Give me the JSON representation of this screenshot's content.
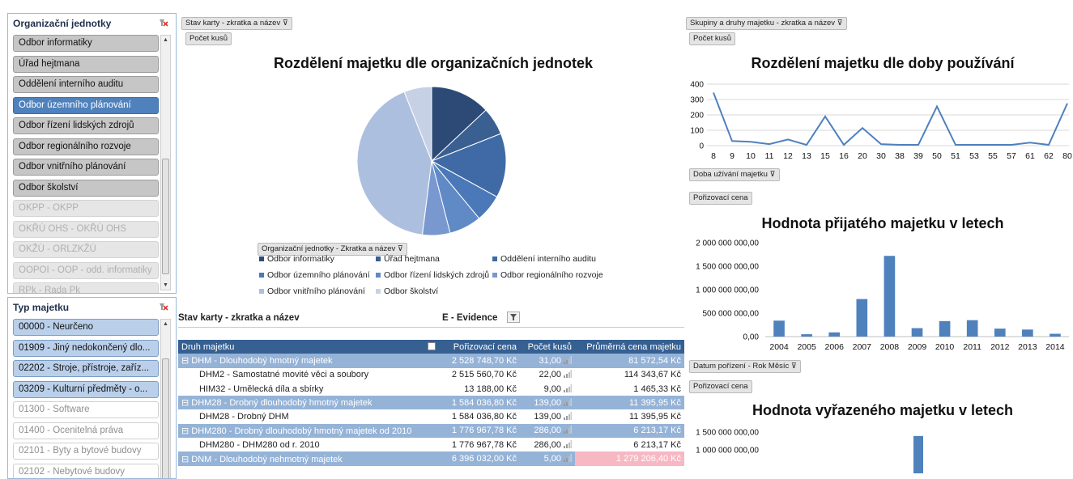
{
  "slicer_org": {
    "title": "Organizační jednotky",
    "items": [
      {
        "label": "Odbor informatiky",
        "state": "grey"
      },
      {
        "label": "Úřad hejtmana",
        "state": "grey"
      },
      {
        "label": "Oddělení interního auditu",
        "state": "grey"
      },
      {
        "label": "Odbor územního plánování",
        "state": "sel"
      },
      {
        "label": "Odbor řízení lidských zdrojů",
        "state": "grey"
      },
      {
        "label": "Odbor regionálního rozvoje",
        "state": "grey"
      },
      {
        "label": "Odbor vnitřního plánování",
        "state": "grey"
      },
      {
        "label": "Odbor školství",
        "state": "grey"
      },
      {
        "label": "OKPP - OKPP",
        "state": "light"
      },
      {
        "label": "OKŘÚ OHS - OKŘÚ OHS",
        "state": "light"
      },
      {
        "label": "OKŽÚ - ORLZKŽÚ",
        "state": "light"
      },
      {
        "label": "OOPOI - OOP - odd. informatiky",
        "state": "light"
      },
      {
        "label": "RPk - Rada Pk",
        "state": "light"
      }
    ]
  },
  "slicer_type": {
    "title": "Typ majetku",
    "items": [
      {
        "label": "00000 - Neurčeno",
        "state": "blue"
      },
      {
        "label": "01909 - Jiný nedokončený dlo...",
        "state": "blue"
      },
      {
        "label": "02202 - Stroje, přístroje, zaříz...",
        "state": "blue"
      },
      {
        "label": "03209 - Kulturní předměty - o...",
        "state": "blue"
      },
      {
        "label": "01300 - Software",
        "state": "white"
      },
      {
        "label": "01400 - Ocenitelná práva",
        "state": "white"
      },
      {
        "label": "02101 - Byty a bytové budovy",
        "state": "white"
      },
      {
        "label": "02102 - Nebytové budovy",
        "state": "white"
      }
    ]
  },
  "pie_section": {
    "filter_button": "Stav karty - zkratka a název",
    "value_button": "Počet kusů",
    "title": "Rozdělení majetku dle organizačních jednotek",
    "legend_button": "Organizační jednotky - Zkratka a název"
  },
  "line_section": {
    "filter_button": "Skupiny a druhy majetku - zkratka a název",
    "value_button": "Počet kusů",
    "title": "Rozdělení majetku dle doby používání",
    "axis_button": "Doba užívání majetku"
  },
  "bar1_section": {
    "value_button": "Pořizovací cena",
    "title": "Hodnota přijatého majetku v letech",
    "axis_button": "Datum pořízení - Rok Měsíc"
  },
  "bar2_section": {
    "value_button": "Pořizovací cena",
    "title": "Hodnota vyřazeného majetku v letech"
  },
  "chart_data": [
    {
      "type": "pie",
      "title": "Rozdělení majetku dle organizačních jednotek",
      "categories": [
        "Odbor informatiky",
        "Úřad hejtmana",
        "Oddělení interního auditu",
        "Odbor územního plánování",
        "Odbor řízení lidských zdrojů",
        "Odbor regionálního rozvoje",
        "Odbor vnitřního plánování",
        "Odbor školství"
      ],
      "values": [
        13,
        6,
        14,
        6,
        7,
        6,
        42,
        6
      ],
      "colors": [
        "#2c4a75",
        "#3a5f91",
        "#3f6aa6",
        "#4a78b8",
        "#5f8ac6",
        "#7898cf",
        "#adbfdf",
        "#c7d1e6"
      ]
    },
    {
      "type": "line",
      "title": "Rozdělení majetku dle doby používání",
      "x": [
        "8",
        "9",
        "10",
        "11",
        "12",
        "13",
        "15",
        "16",
        "20",
        "30",
        "38",
        "39",
        "50",
        "51",
        "53",
        "55",
        "57",
        "61",
        "62",
        "80"
      ],
      "values": [
        345,
        30,
        25,
        10,
        40,
        5,
        190,
        5,
        115,
        10,
        5,
        5,
        255,
        5,
        5,
        5,
        5,
        20,
        5,
        275
      ],
      "ylim": [
        0,
        400
      ],
      "yticks": [
        "400",
        "300",
        "200",
        "100",
        "0"
      ]
    },
    {
      "type": "bar",
      "title": "Hodnota přijatého majetku v letech",
      "categories": [
        "2004",
        "2005",
        "2006",
        "2007",
        "2008",
        "2009",
        "2010",
        "2011",
        "2012",
        "2013",
        "2014"
      ],
      "values": [
        340000000,
        50000000,
        90000000,
        800000000,
        1720000000,
        180000000,
        330000000,
        350000000,
        170000000,
        150000000,
        60000000
      ],
      "ylim": [
        0,
        2000000000
      ],
      "yticks": [
        "2 000 000 000,00",
        "1 500 000 000,00",
        "1 000 000 000,00",
        "500 000 000,00",
        "0,00"
      ]
    },
    {
      "type": "bar",
      "title": "Hodnota vyřazeného majetku v letech",
      "categories": [],
      "values": [
        1390000000
      ],
      "ylim": [
        0,
        1500000000
      ],
      "yticks": [
        "1 500 000 000,00",
        "1 000 000 000,00"
      ]
    }
  ],
  "table": {
    "top_label": "Stav karty - zkratka a název",
    "top_value": "E - Evidence",
    "headers": [
      "Druh majetku",
      "Pořizovací cena",
      "Počet kusů",
      "Průměrná cena majetku"
    ],
    "rows": [
      {
        "kind": "grp",
        "name": "DHM - Dlouhodobý hmotný majetek",
        "cena": "2 528 748,70 Kč",
        "kusu": "31,00",
        "prumer": "81 572,54 Kč"
      },
      {
        "kind": "sub",
        "name": "DHM2 - Samostatné movité věci a soubory",
        "cena": "2 515 560,70 Kč",
        "kusu": "22,00",
        "prumer": "114 343,67 Kč"
      },
      {
        "kind": "sub",
        "name": "HIM32 - Umělecká díla a sbírky",
        "cena": "13 188,00 Kč",
        "kusu": "9,00",
        "prumer": "1 465,33 Kč"
      },
      {
        "kind": "grp",
        "name": "DHM28 - Drobný dlouhodobý hmotný majetek",
        "cena": "1 584 036,80 Kč",
        "kusu": "139,00",
        "prumer": "11 395,95 Kč"
      },
      {
        "kind": "sub",
        "name": "DHM28 - Drobný DHM",
        "cena": "1 584 036,80 Kč",
        "kusu": "139,00",
        "prumer": "11 395,95 Kč"
      },
      {
        "kind": "grp",
        "name": "DHM280 - Drobný dlouhodobý hmotný majetek od 2010",
        "cena": "1 776 967,78 Kč",
        "kusu": "286,00",
        "prumer": "6 213,17 Kč"
      },
      {
        "kind": "sub",
        "name": "DHM280 - DHM280 od r. 2010",
        "cena": "1 776 967,78 Kč",
        "kusu": "286,00",
        "prumer": "6 213,17 Kč"
      },
      {
        "kind": "grp",
        "name": "DNM - Dlouhodobý nehmotný majetek",
        "cena": "6 396 032,00 Kč",
        "kusu": "5,00",
        "prumer": "1 279 206,40 Kč",
        "highlight": true
      }
    ]
  }
}
